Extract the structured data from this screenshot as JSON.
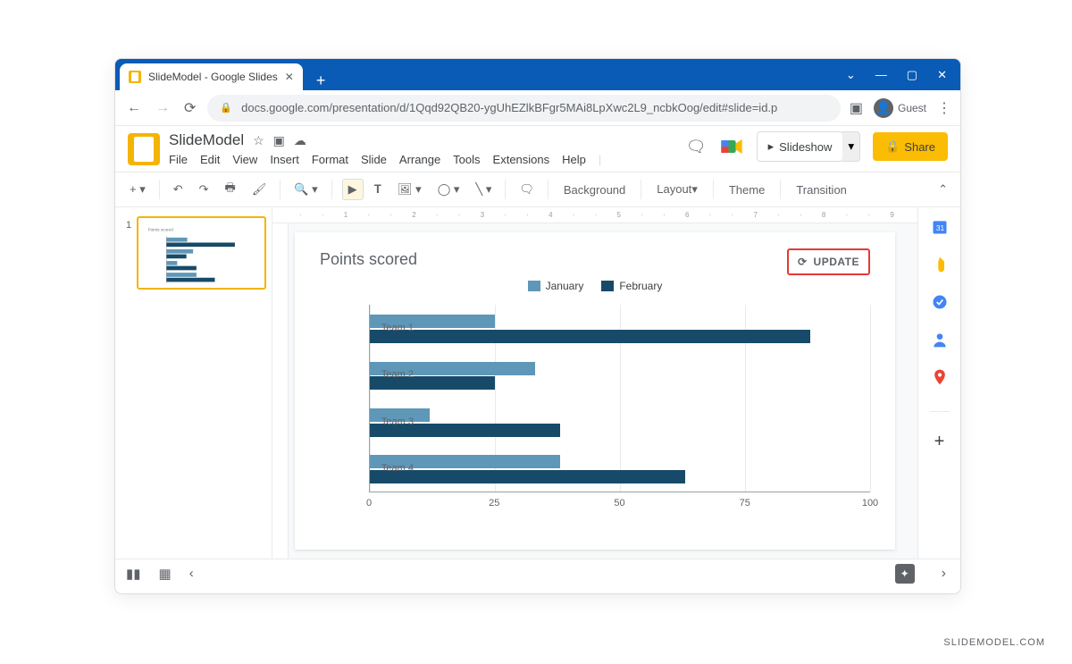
{
  "browser": {
    "tab_title": "SlideModel - Google Slides",
    "url": "docs.google.com/presentation/d/1Qqd92QB20-ygUhEZlkBFgr5MAi8LpXwc2L9_ncbkOog/edit#slide=id.p",
    "guest": "Guest"
  },
  "doc": {
    "title": "SlideModel",
    "menus": [
      "File",
      "Edit",
      "View",
      "Insert",
      "Format",
      "Slide",
      "Arrange",
      "Tools",
      "Extensions",
      "Help"
    ]
  },
  "buttons": {
    "slideshow": "Slideshow",
    "share": "Share",
    "update": "UPDATE"
  },
  "toolbar": {
    "background": "Background",
    "layout": "Layout",
    "theme": "Theme",
    "transition": "Transition"
  },
  "thumb": {
    "number": "1"
  },
  "chart_data": {
    "type": "bar",
    "orientation": "horizontal",
    "title": "Points scored",
    "categories": [
      "Team 1",
      "Team 2",
      "Team 3",
      "Team 4"
    ],
    "series": [
      {
        "name": "January",
        "values": [
          25,
          33,
          12,
          38
        ],
        "color": "#5e97b8"
      },
      {
        "name": "February",
        "values": [
          88,
          25,
          38,
          63
        ],
        "color": "#174a68"
      }
    ],
    "xlabel": "",
    "ylabel": "",
    "xticks": [
      0,
      25,
      50,
      75,
      100
    ],
    "xlim": [
      0,
      100
    ]
  },
  "watermark": "SLIDEMODEL.COM"
}
